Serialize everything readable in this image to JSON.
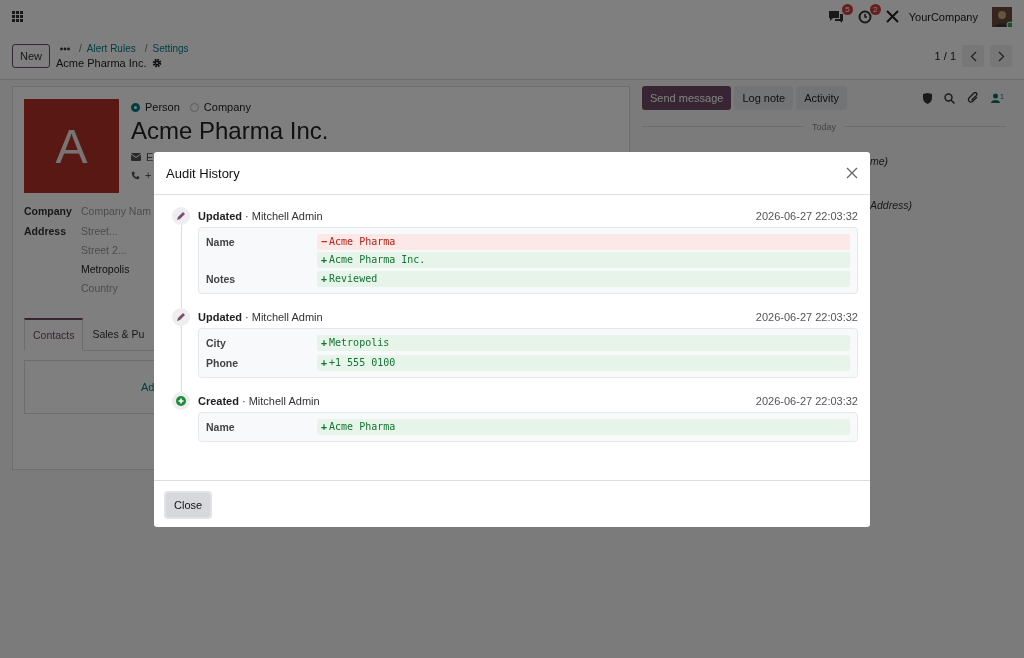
{
  "navbar": {
    "chat_badge": "5",
    "activity_badge": "2",
    "company": "YourCompany"
  },
  "control_panel": {
    "new_button": "New",
    "separator": "/",
    "breadcrumbs": [
      "Alert Rules",
      "Settings"
    ],
    "record_title": "Acme Pharma Inc.",
    "pager": "1 / 1"
  },
  "form": {
    "avatar_letter": "A",
    "company_type": [
      {
        "label": "Person",
        "selected": true
      },
      {
        "label": "Company",
        "selected": false
      }
    ],
    "name": "Acme Pharma Inc.",
    "email_fragment": "E",
    "phone_fragment": "+",
    "fields": [
      {
        "label": "Company",
        "values": [
          {
            "placeholder": "Company Nam"
          }
        ]
      },
      {
        "label": "Address",
        "values": [
          {
            "placeholder": "Street..."
          },
          {
            "placeholder": "Street 2..."
          },
          {
            "value": "Metropolis"
          },
          {
            "placeholder": "Country"
          }
        ]
      }
    ],
    "tabs": [
      {
        "label": "Contacts",
        "selected": true
      },
      {
        "label": "Sales & Pu",
        "selected": false
      }
    ],
    "add_link": "Ad"
  },
  "chatter": {
    "buttons": [
      {
        "label": "Send message",
        "kind": "primary"
      },
      {
        "label": "Log note",
        "kind": "secondary"
      },
      {
        "label": "Activity",
        "kind": "secondary"
      }
    ],
    "follower_count": "1",
    "separator": "Today",
    "log_fragments": [
      "me)",
      "Address)"
    ]
  },
  "dialog": {
    "title": "Audit History",
    "entries": [
      {
        "kind": "updated",
        "action": "Updated",
        "author": "· Mitchell Admin",
        "timestamp": "2026-06-27 22:03:32",
        "changes": [
          {
            "field": "Name",
            "lines": [
              {
                "kind": "removed",
                "sign": "−",
                "text": "Acme Pharma"
              },
              {
                "kind": "added",
                "sign": "+",
                "text": "Acme Pharma Inc."
              }
            ]
          },
          {
            "field": "Notes",
            "lines": [
              {
                "kind": "added",
                "sign": "+",
                "text": "Reviewed"
              }
            ]
          }
        ]
      },
      {
        "kind": "updated",
        "action": "Updated",
        "author": "· Mitchell Admin",
        "timestamp": "2026-06-27 22:03:32",
        "changes": [
          {
            "field": "City",
            "lines": [
              {
                "kind": "added",
                "sign": "+",
                "text": "Metropolis"
              }
            ]
          },
          {
            "field": "Phone",
            "lines": [
              {
                "kind": "added",
                "sign": "+",
                "text": "+1 555 0100"
              }
            ]
          }
        ]
      },
      {
        "kind": "created",
        "action": "Created",
        "author": "· Mitchell Admin",
        "timestamp": "2026-06-27 22:03:32",
        "changes": [
          {
            "field": "Name",
            "lines": [
              {
                "kind": "added",
                "sign": "+",
                "text": "Acme Pharma"
              }
            ]
          }
        ]
      }
    ],
    "close_button": "Close"
  }
}
